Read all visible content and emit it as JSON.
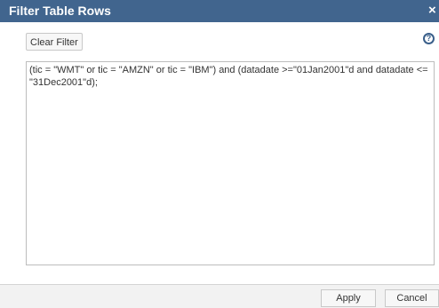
{
  "dialog": {
    "title": "Filter Table Rows",
    "close_glyph": "×",
    "help_glyph": "?"
  },
  "toolbar": {
    "clear_filter_label": "Clear Filter"
  },
  "filter": {
    "expression": "(tic = \"WMT\" or tic = \"AMZN\" or tic = \"IBM\") and (datadate >=\"01Jan2001\"d and datadate <= \"31Dec2001\"d);"
  },
  "footer": {
    "apply_label": "Apply",
    "cancel_label": "Cancel"
  },
  "colors": {
    "titlebar": "#41658e",
    "help_accent": "#3a5f8a"
  }
}
